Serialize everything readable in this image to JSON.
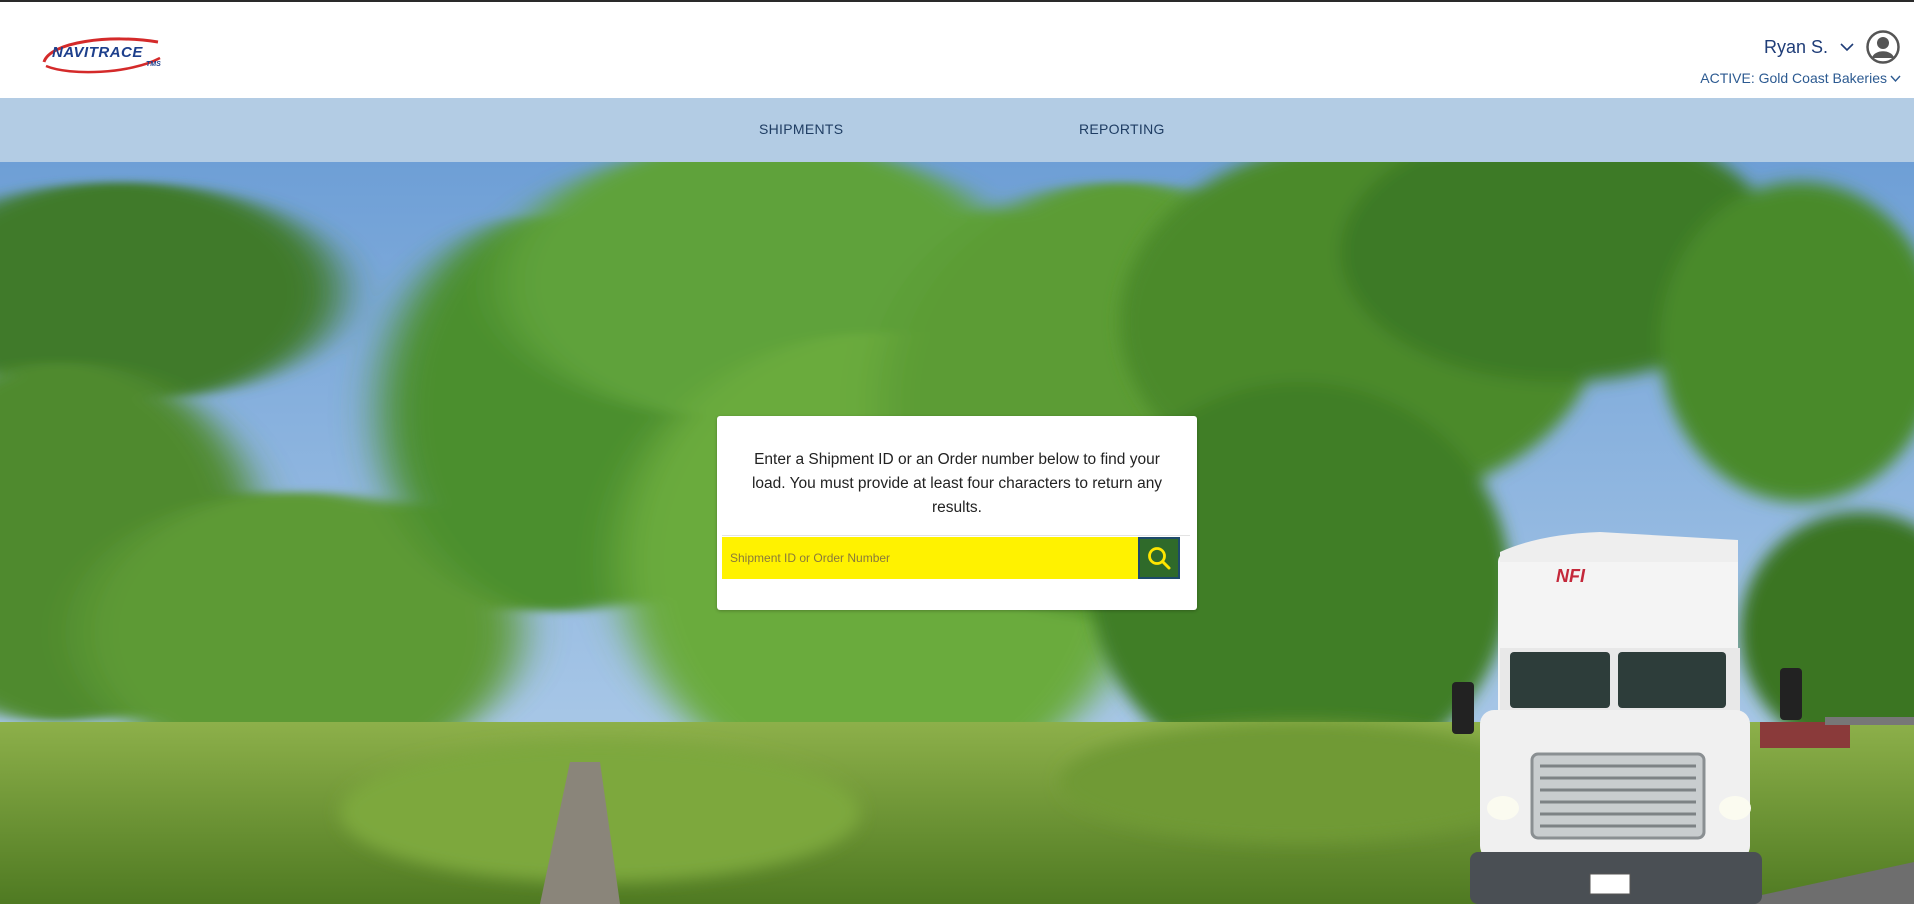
{
  "header": {
    "logo_text": "NAVITRACE",
    "logo_sub": "TMS",
    "user_name": "Ryan S.",
    "active_account": "ACTIVE: Gold Coast Bakeries"
  },
  "nav": {
    "items": [
      {
        "label": "SHIPMENTS"
      },
      {
        "label": "REPORTING"
      }
    ]
  },
  "search": {
    "instructions": "Enter a Shipment ID or an Order number below to find your load. You must provide at least four characters to return any results.",
    "placeholder": "Shipment ID or Order Number",
    "value": ""
  },
  "hero": {
    "truck_brand": "NFI"
  },
  "icons": {
    "user_menu": "chevron-down-icon",
    "avatar": "user-avatar-icon",
    "account_menu": "chevron-down-icon",
    "search": "search-icon"
  },
  "colors": {
    "brand_navy": "#1d3f8c",
    "brand_red": "#d42a2a",
    "nav_bar": "#b3cce4",
    "search_highlight": "#fff200",
    "search_button": "#2f6a2a"
  }
}
